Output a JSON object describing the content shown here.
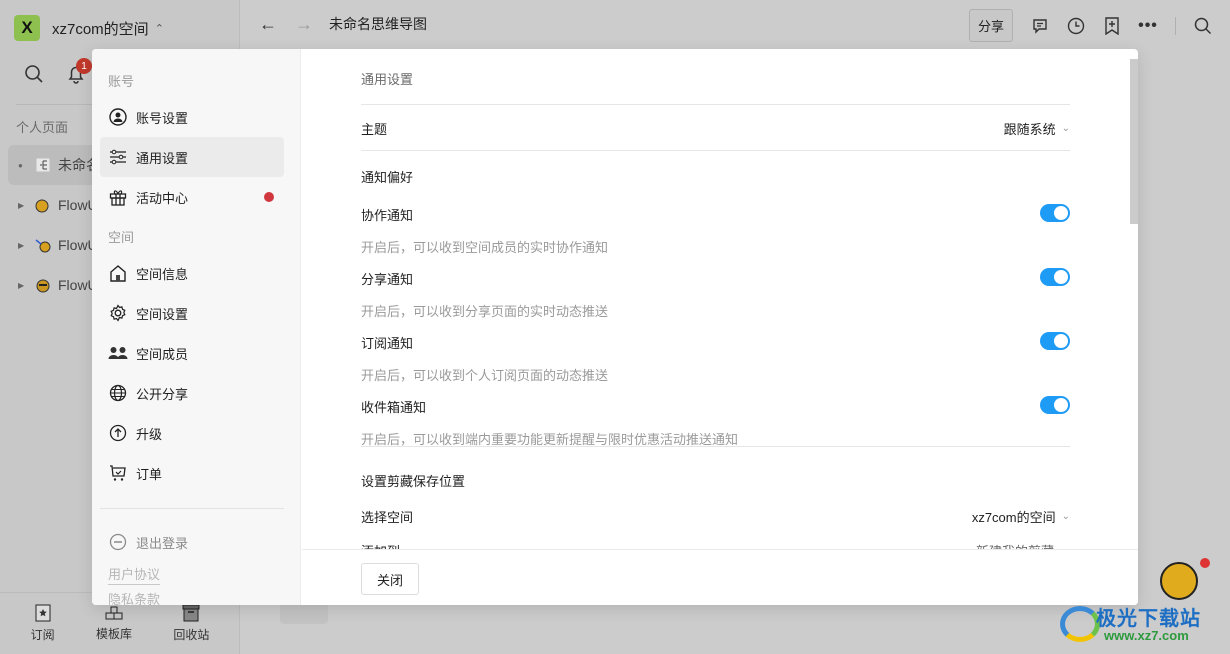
{
  "app": {
    "workspace": {
      "logo_letter": "X",
      "name": "xz7com的空间",
      "switch_icon": "chevron-up-down"
    },
    "notifications_badge": "1",
    "sidebar": {
      "section_label": "个人页面",
      "tree": [
        {
          "label": "未命名思维导图",
          "icon": "mindmap-icon",
          "active": true
        },
        {
          "label": "FlowUs",
          "icon": "bee-icon-1",
          "active": false
        },
        {
          "label": "FlowUs",
          "icon": "bee-icon-2",
          "active": false
        },
        {
          "label": "FlowUs",
          "icon": "bee-icon-3",
          "active": false
        }
      ],
      "bottom": [
        {
          "label": "订阅",
          "icon": "subscribe-icon"
        },
        {
          "label": "模板库",
          "icon": "template-icon"
        },
        {
          "label": "回收站",
          "icon": "trash-icon"
        }
      ]
    },
    "topbar": {
      "title": "未命名思维导图",
      "share_label": "分享",
      "icons": [
        "comment-icon",
        "history-icon",
        "bookmark-add-icon",
        "more-icon",
        "search-icon"
      ]
    }
  },
  "modal": {
    "nav": {
      "account_label": "账号",
      "account_items": [
        {
          "label": "账号设置",
          "icon": "user-circle-icon"
        },
        {
          "label": "通用设置",
          "icon": "sliders-icon",
          "active": true
        },
        {
          "label": "活动中心",
          "icon": "gift-icon",
          "dot": true
        }
      ],
      "space_label": "空间",
      "space_items": [
        {
          "label": "空间信息",
          "icon": "home-icon"
        },
        {
          "label": "空间设置",
          "icon": "gear-icon"
        },
        {
          "label": "空间成员",
          "icon": "members-icon"
        },
        {
          "label": "公开分享",
          "icon": "globe-icon"
        },
        {
          "label": "升级",
          "icon": "upgrade-icon"
        },
        {
          "label": "订单",
          "icon": "cart-icon"
        }
      ],
      "logout": "退出登录",
      "user_agreement": "用户协议",
      "privacy": "隐私条款"
    },
    "content": {
      "title": "通用设置",
      "theme": {
        "label": "主题",
        "value": "跟随系统"
      },
      "notify_section": "通知偏好",
      "notifications": [
        {
          "label": "协作通知",
          "desc": "开启后，可以收到空间成员的实时协作通知",
          "enabled": true
        },
        {
          "label": "分享通知",
          "desc": "开启后，可以收到分享页面的实时动态推送",
          "enabled": true
        },
        {
          "label": "订阅通知",
          "desc": "开启后，可以收到个人订阅页面的动态推送",
          "enabled": true
        },
        {
          "label": "收件箱通知",
          "desc": "开启后，可以收到端内重要功能更新提醒与限时优惠活动推送通知",
          "enabled": true
        }
      ],
      "clip_section": "设置剪藏保存位置",
      "select_space": {
        "label": "选择空间",
        "value": "xz7com的空间"
      },
      "add_to": {
        "label": "添加到",
        "value": "新建我的剪藏"
      }
    },
    "footer": {
      "close_label": "关闭"
    }
  },
  "watermark": {
    "text": "极光下载站",
    "url": "www.xz7.com"
  },
  "colors": {
    "toggle_on": "#1e9bf5",
    "red_dot": "#d1373f",
    "ws_logo": "#8ec04f"
  }
}
